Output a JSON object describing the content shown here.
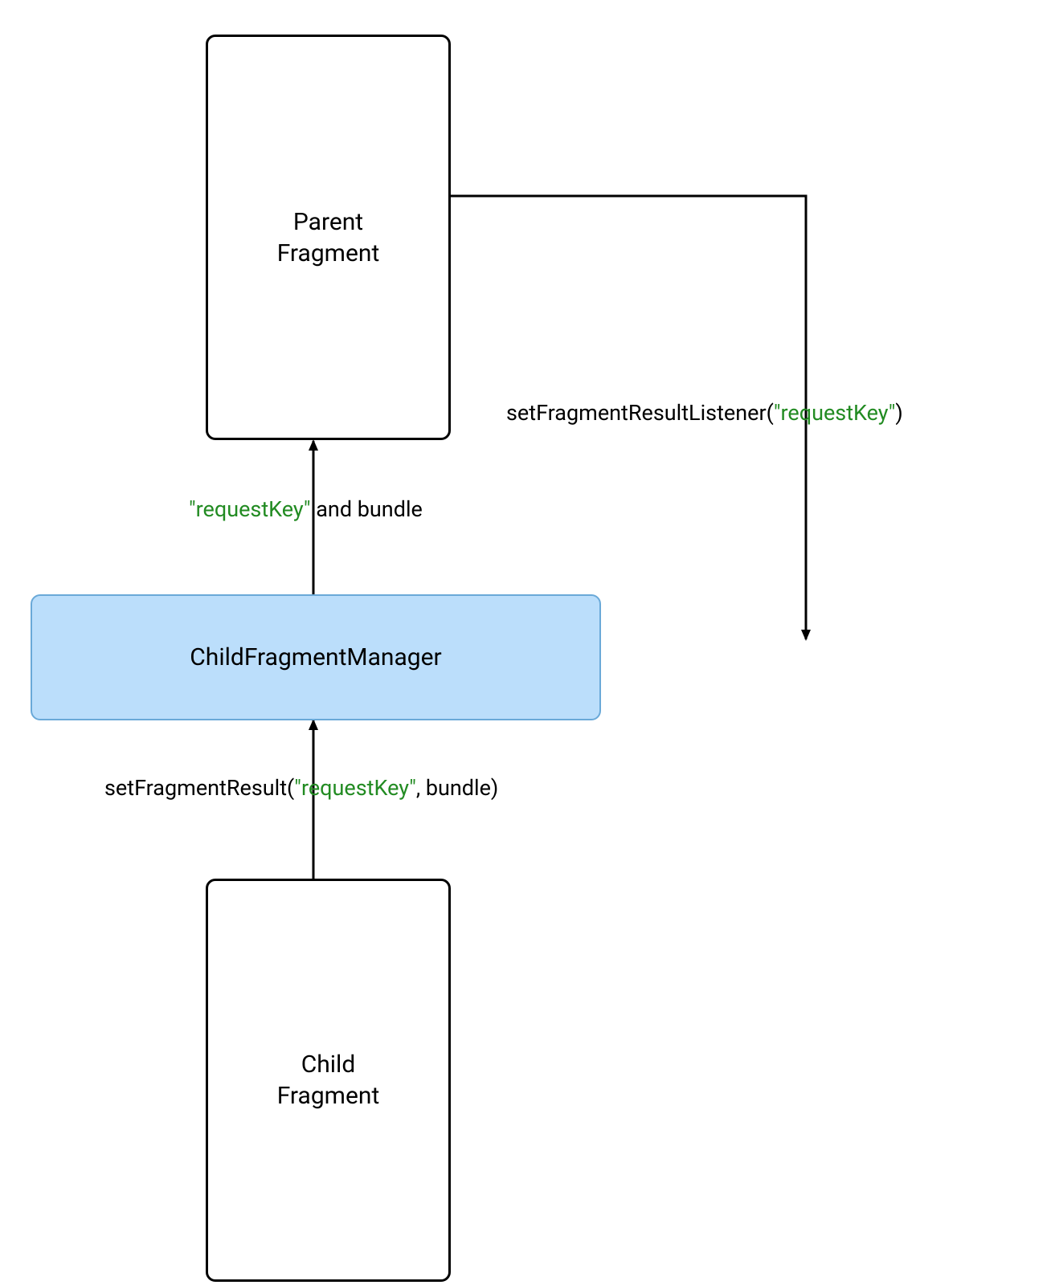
{
  "nodes": {
    "parent": {
      "line1": "Parent",
      "line2": "Fragment"
    },
    "manager": {
      "label": "ChildFragmentManager"
    },
    "child": {
      "line1": "Child",
      "line2": "Fragment"
    }
  },
  "labels": {
    "listener_prefix": "setFragmentResultListener(",
    "listener_key": "\"requestKey\"",
    "listener_suffix": ")",
    "up_key": "\"requestKey\"",
    "up_rest": " and bundle",
    "result_prefix": "setFragmentResult(",
    "result_key": "\"requestKey\"",
    "result_suffix": ", bundle)"
  },
  "colors": {
    "manager_fill": "#bbdefb",
    "manager_border": "#6aa9d8",
    "key_color": "#228b22"
  }
}
